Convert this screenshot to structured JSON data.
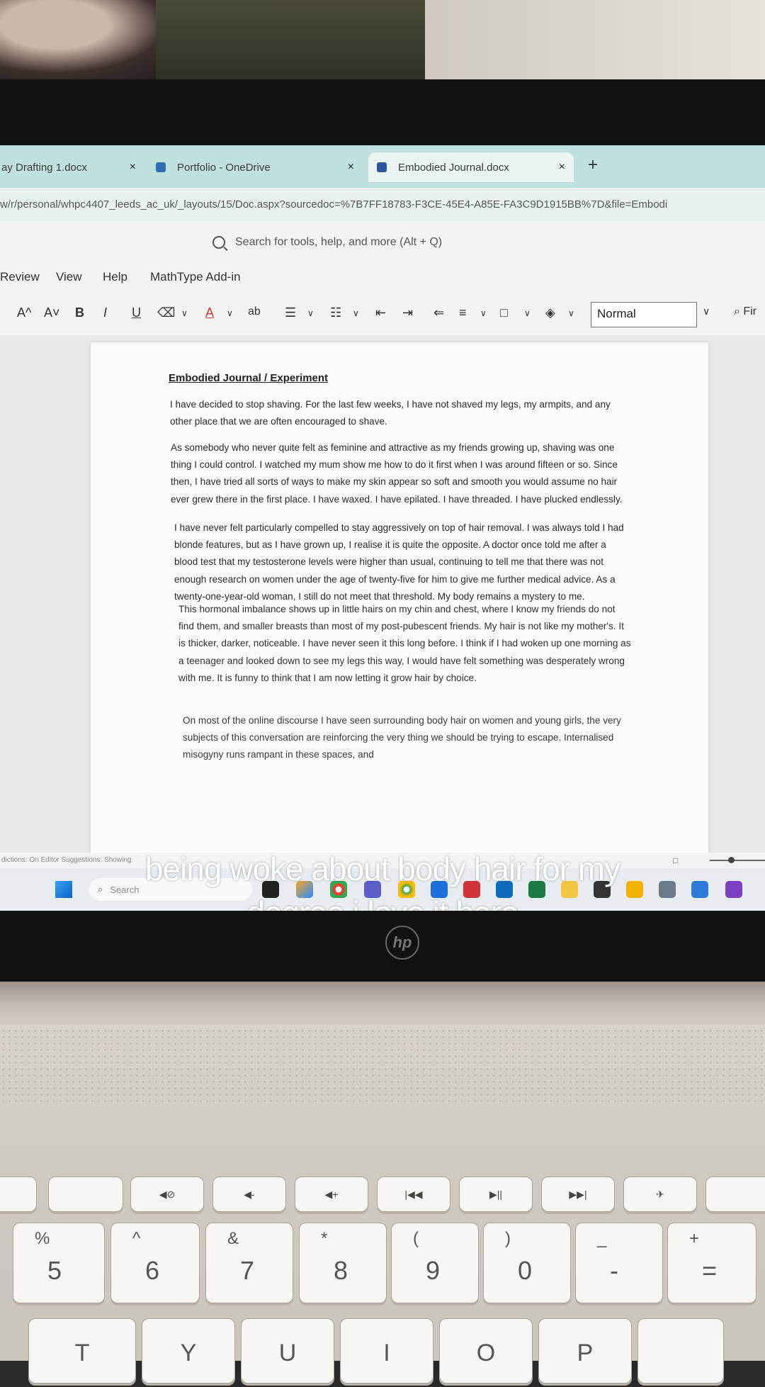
{
  "browser": {
    "tabs": [
      {
        "label": "ay Drafting 1.docx",
        "close": "×"
      },
      {
        "label": "Portfolio - OneDrive",
        "close": "×"
      },
      {
        "label": "Embodied Journal.docx",
        "close": "×"
      }
    ],
    "new_tab": "+",
    "url": "w/r/personal/whpc4407_leeds_ac_uk/_layouts/15/Doc.aspx?sourcedoc=%7B7FF18783-F3CE-45E4-A85E-FA3C9D1915BB%7D&file=Embodi"
  },
  "word": {
    "search_placeholder": "Search for tools, help, and more (Alt + Q)",
    "menus": [
      "Review",
      "View",
      "Help",
      "MathType Add-in"
    ],
    "toolbar": {
      "grow_font": "A^",
      "shrink_font": "A˅",
      "bold": "B",
      "italic": "I",
      "underline": "U",
      "highlight": "ab",
      "font_color": "A",
      "style_value": "Normal",
      "find": "Fir"
    },
    "status_text": "dictions: On   Editor Suggestions: Showing",
    "zoom_box": "□"
  },
  "document": {
    "title": "Embodied Journal / Experiment",
    "paragraphs": [
      "I have decided to stop shaving. For the last few weeks, I have not shaved my legs, my armpits, and any other place that we are often encouraged to shave.",
      "As somebody who never quite felt as feminine and attractive as my friends growing up, shaving was one thing I could control. I watched my mum show me how to do it first when I was around fifteen or so. Since then, I have tried all sorts of ways to make my skin appear so soft and smooth you would assume no hair ever grew there in the first place. I have waxed. I have epilated. I have threaded. I have plucked endlessly.",
      "I have never felt particularly compelled to stay aggressively on top of hair removal. I was always told I had blonde features, but as I have grown up, I realise it is quite the opposite. A doctor once told me after a blood test that my testosterone levels were higher than usual, continuing to tell me that there was not enough research on women under the age of twenty-five for him to give me further medical advice. As a twenty-one-year-old woman, I still do not meet that threshold. My body remains a mystery to me.",
      "This hormonal imbalance shows up in little hairs on my chin and chest, where I know my friends do not find them, and smaller breasts than most of my post-pubescent friends. My hair is not like my mother's. It is thicker, darker, noticeable. I have never seen it this long before. I think if I had woken up one morning as a teenager and looked down to see my legs this way, I would have felt something was desperately wrong with me. It is funny to think that I am now letting it grow hair by choice.",
      "On most of the online discourse I have seen surrounding body hair on women and young girls, the very subjects of this conversation are reinforcing the very thing we should be trying to escape. Internalised misogyny runs rampant in these spaces, and"
    ]
  },
  "taskbar": {
    "search_placeholder": "Search"
  },
  "caption": "being woke about body hair for my degree i love it here",
  "laptop": {
    "brand": "hp",
    "fn_keys": [
      "",
      "",
      "◀⊘",
      "◀-",
      "◀+",
      "|◀◀",
      "▶||",
      "▶▶|",
      "✈"
    ],
    "number_keys": [
      {
        "sym": "%",
        "dig": "5"
      },
      {
        "sym": "^",
        "dig": "6"
      },
      {
        "sym": "&",
        "dig": "7"
      },
      {
        "sym": "*",
        "dig": "8"
      },
      {
        "sym": "(",
        "dig": "9"
      },
      {
        "sym": ")",
        "dig": "0"
      },
      {
        "sym": "_",
        "dig": "-"
      },
      {
        "sym": "+",
        "dig": "="
      }
    ],
    "letter_keys": [
      "T",
      "Y",
      "U",
      "I",
      "O",
      "P"
    ]
  }
}
